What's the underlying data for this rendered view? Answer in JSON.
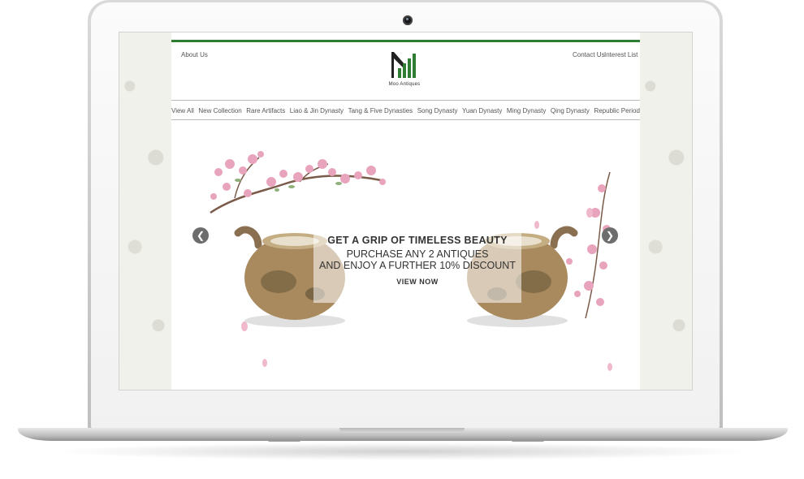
{
  "site": {
    "brand": "Moo Antiques",
    "links": {
      "about": "About Us",
      "contact": "Contact Us",
      "interest": "Interest List"
    },
    "nav": [
      "View All",
      "New Collection",
      "Rare Artifacts",
      "Liao & Jin Dynasty",
      "Tang & Five Dynasties",
      "Song Dynasty",
      "Yuan Dynasty",
      "Ming Dynasty",
      "Qing Dynasty",
      "Republic Period"
    ],
    "banner": {
      "title": "GET A GRIP OF TIMELESS BEAUTY",
      "line1": "PURCHASE ANY 2 ANTIQUES",
      "line2": "AND ENJOY A FURTHER 10% DISCOUNT",
      "cta": "VIEW NOW"
    },
    "icons": {
      "prev": "chevron-left-icon",
      "next": "chevron-right-icon"
    },
    "colors": {
      "accent": "#2e7d32"
    }
  }
}
